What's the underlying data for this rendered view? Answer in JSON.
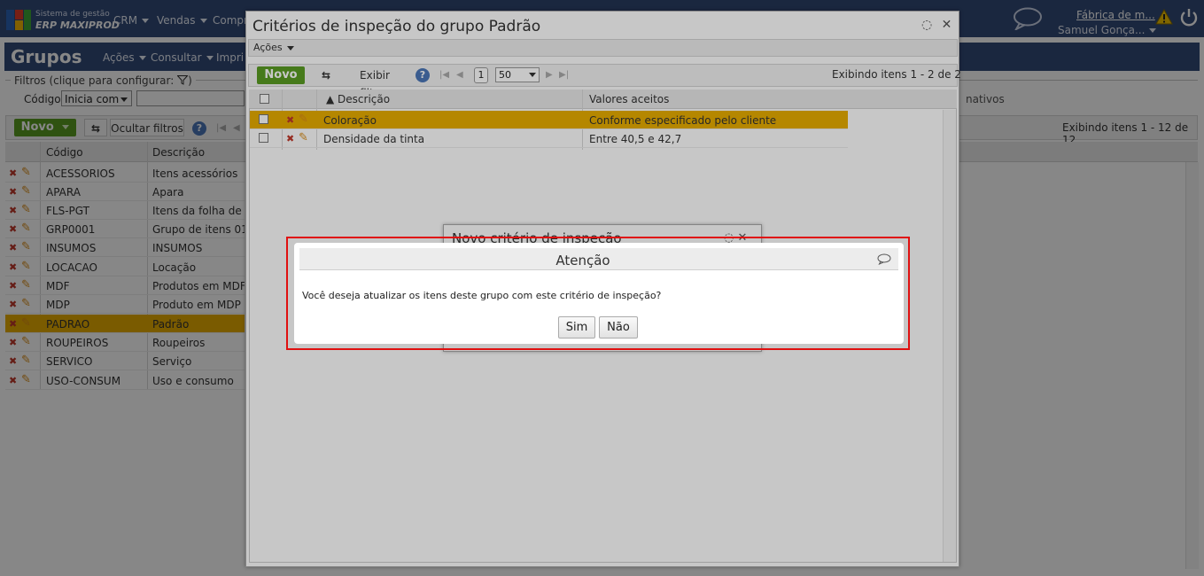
{
  "app": {
    "brand_line1": "Sistema de gestão",
    "brand_line2": "ERP MAXIPROD",
    "menus": [
      "CRM",
      "Vendas",
      "Compr"
    ],
    "company": "Fábrica de m...",
    "user": "Samuel Gonça...",
    "colors": {
      "header": "#334a78",
      "accent_green": "#5a9d23",
      "selected_row": "#e8ad00"
    }
  },
  "page": {
    "title": "Grupos",
    "submenu": [
      "Ações",
      "Consultar",
      "Impri"
    ],
    "filters_legend": "Filtros (clique para configurar:",
    "filter_field_label": "Código",
    "filter_operator": "Inicia com",
    "toolbar": {
      "new_label": "Novo",
      "toggle_filters_label": "Ocultar filtros",
      "count_text": "Exibindo itens 1 - 12 de 12"
    },
    "right_header_fragment": "nativos",
    "columns": [
      "Código",
      "Descrição"
    ],
    "rows": [
      {
        "code": "ACESSORIOS",
        "desc": "Itens acessórios"
      },
      {
        "code": "APARA",
        "desc": "Apara"
      },
      {
        "code": "FLS-PGT",
        "desc": "Itens da folha de p"
      },
      {
        "code": "GRP0001",
        "desc": "Grupo de itens 01"
      },
      {
        "code": "INSUMOS",
        "desc": "INSUMOS"
      },
      {
        "code": "LOCACAO",
        "desc": "Locação"
      },
      {
        "code": "MDF",
        "desc": "Produtos em MDF"
      },
      {
        "code": "MDP",
        "desc": "Produto em MDP"
      },
      {
        "code": "PADRAO",
        "desc": "Padrão",
        "selected": true
      },
      {
        "code": "ROUPEIROS",
        "desc": "Roupeiros"
      },
      {
        "code": "SERVICO",
        "desc": "Serviço"
      },
      {
        "code": "USO-CONSUM",
        "desc": "Uso e consumo"
      }
    ]
  },
  "criteria_dialog": {
    "title": "Critérios de inspeção do grupo Padrão",
    "actions_label": "Ações",
    "new_label": "Novo",
    "show_filters_label": "Exibir filtros",
    "page_number": "1",
    "page_size": "50",
    "count_text": "Exibindo itens 1 - 2 de 2",
    "columns": [
      "Descrição",
      "Valores aceitos"
    ],
    "rows": [
      {
        "desc": "Coloração",
        "values": "Conforme especificado pelo cliente",
        "selected": true
      },
      {
        "desc": "Densidade da tinta",
        "values": "Entre 40,5 e 42,7"
      }
    ]
  },
  "new_criterion_dialog": {
    "title": "Novo critério de inspeção"
  },
  "attention_dialog": {
    "title": "Atenção",
    "message": "Você deseja atualizar os itens deste grupo com este critério de inspeção?",
    "yes_label": "Sim",
    "no_label": "Não"
  }
}
